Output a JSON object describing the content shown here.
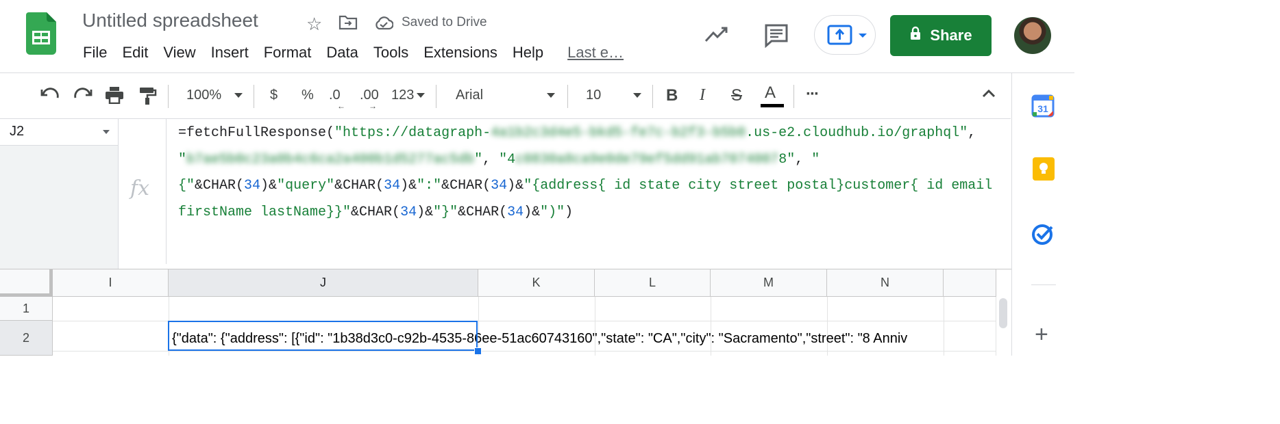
{
  "doc": {
    "title": "Untitled spreadsheet",
    "save_status": "Saved to Drive"
  },
  "menu": [
    "File",
    "Edit",
    "View",
    "Insert",
    "Format",
    "Data",
    "Tools",
    "Extensions",
    "Help"
  ],
  "last_edit": "Last e…",
  "share_label": "Share",
  "toolbar": {
    "zoom": "100%",
    "currency": "$",
    "percent": "%",
    "decrease_decimal": ".0",
    "increase_decimal": ".00",
    "more_formats": "123",
    "font": "Arial",
    "font_size": "10",
    "bold": "B",
    "italic": "I",
    "strikethrough": "S",
    "text_color": "A",
    "more": "···"
  },
  "name_box": "J2",
  "formula": {
    "l1_a": "=fetchFullResponse(",
    "l1_b": "\"https://datagraph-",
    "l1_blur": "4a1b2c3d4e5-bkd5-fe7c-b2f3-b5b0",
    "l1_c": ".us-e2.cloudhub.io/graphql\"",
    "l1_d": ",",
    "l2_a": "\"",
    "l2_blur": "b7ae5b0c23a0b4c6ca2a400b1d5277ac5db",
    "l2_b": "\"",
    "l2_c": ", ",
    "l2_d": "\"4",
    "l2_blur2": "c0830a8ca9e0de79ef5dd91ab7074007",
    "l2_e": "8\"",
    "l2_f": ", ",
    "l2_g": "\"",
    "l3_a": "{\"",
    "l3_b": "&CHAR(",
    "l3_n1": "34",
    "l3_c": ")&",
    "l3_d": "\"query\"",
    "l3_e": "&CHAR(",
    "l3_n2": "34",
    "l3_f": ")&",
    "l3_g": "\":\"",
    "l3_h": "&CHAR(",
    "l3_n3": "34",
    "l3_i": ")&",
    "l3_j": "\"{address{ id state city street postal}customer{ id email",
    "l4_a": "firstName lastName}}\"",
    "l4_b": "&CHAR(",
    "l4_n1": "34",
    "l4_c": ")&",
    "l4_d": "\"}\"",
    "l4_e": "&CHAR(",
    "l4_n2": "34",
    "l4_f": ")&",
    "l4_g": "\")\"",
    "l4_h": ")"
  },
  "columns": [
    "I",
    "J",
    "K",
    "L",
    "M",
    "N"
  ],
  "rows": [
    "1",
    "2"
  ],
  "cell_J2": "{\"data\": {\"address\": [{\"id\": \"1b38d3c0-c92b-4535-86ee-51ac60743160\",\"state\": \"CA\",\"city\": \"Sacramento\",\"street\": \"8 Anniv",
  "side_calendar_day": "31",
  "colors": {
    "share_green": "#188038",
    "selection_blue": "#1a73e8",
    "formula_green": "#188038",
    "formula_number_blue": "#1967d2"
  }
}
